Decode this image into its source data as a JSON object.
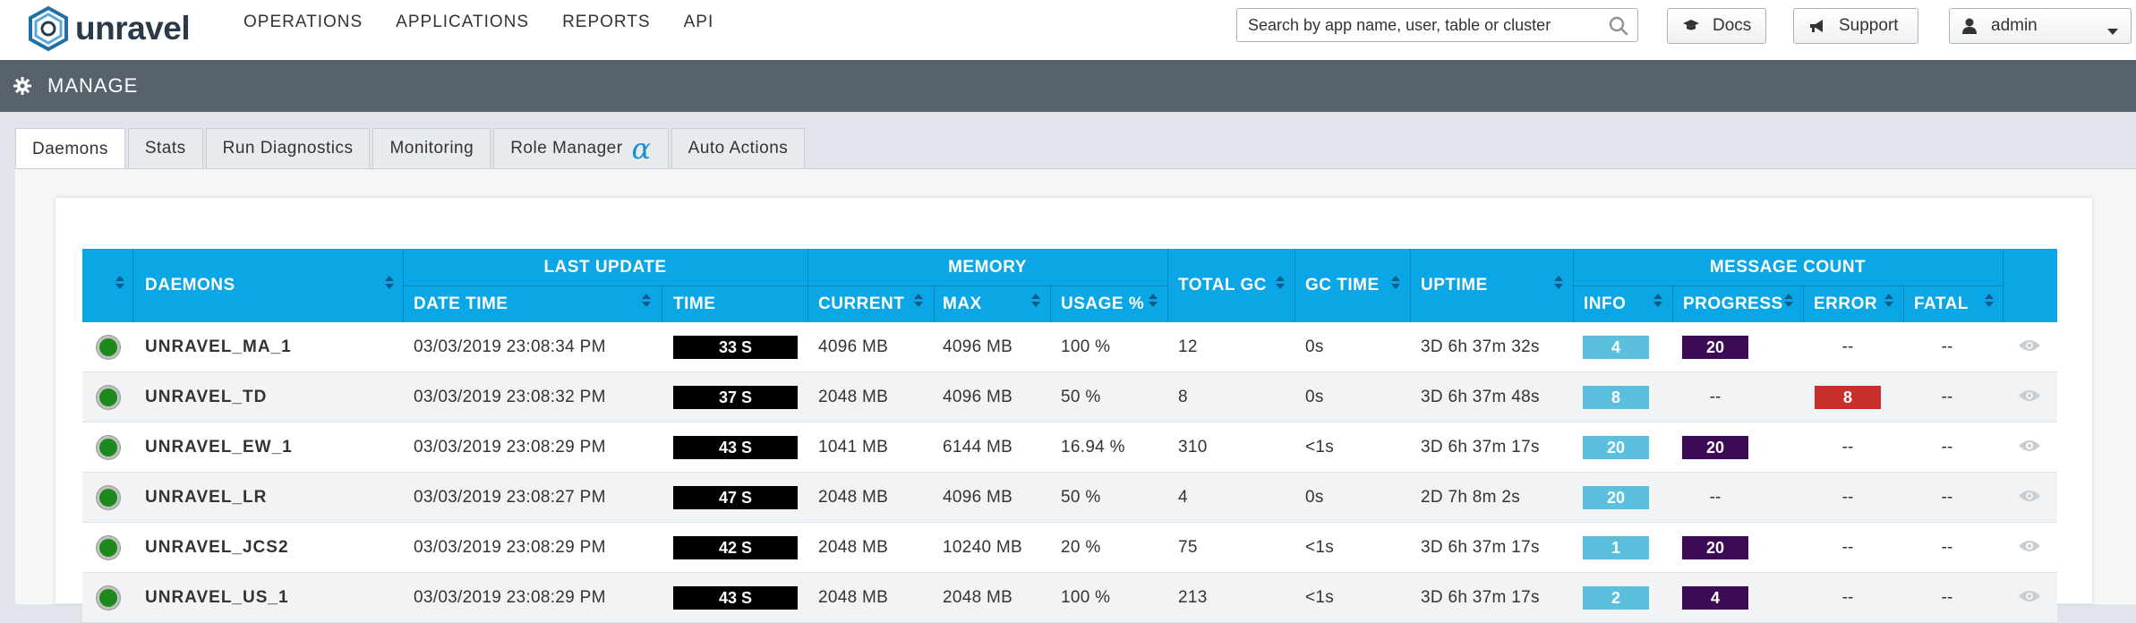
{
  "brand": {
    "name": "unravel"
  },
  "nav": [
    "OPERATIONS",
    "APPLICATIONS",
    "REPORTS",
    "API"
  ],
  "search": {
    "placeholder": "Search by app name, user, table or cluster"
  },
  "buttons": {
    "docs": "Docs",
    "support": "Support",
    "user": "admin"
  },
  "page": {
    "title": "MANAGE"
  },
  "tabs": [
    {
      "label": "Daemons",
      "active": true
    },
    {
      "label": "Stats"
    },
    {
      "label": "Run Diagnostics"
    },
    {
      "label": "Monitoring"
    },
    {
      "label": "Role Manager",
      "badge": "α"
    },
    {
      "label": "Auto Actions"
    }
  ],
  "table": {
    "group_headers": {
      "last_update": "LAST UPDATE",
      "memory": "MEMORY",
      "message_count": "MESSAGE COUNT"
    },
    "headers": {
      "daemons": "DAEMONS",
      "date_time": "DATE TIME",
      "time": "TIME",
      "current": "CURRENT",
      "max": "MAX",
      "usage": "USAGE %",
      "total_gc": "TOTAL GC",
      "gc_time": "GC TIME",
      "uptime": "UPTIME",
      "info": "INFO",
      "progress": "PROGRESS",
      "error": "ERROR",
      "fatal": "FATAL"
    },
    "rows": [
      {
        "name": "UNRAVEL_MA_1",
        "date": "03/03/2019 23:08:34 PM",
        "time": "33 S",
        "current": "4096 MB",
        "max": "4096 MB",
        "usage": "100 %",
        "gc": "12",
        "gc_time": "0s",
        "uptime": "3D 6h 37m 32s",
        "info": "4",
        "progress": "20",
        "error": "--",
        "fatal": "--"
      },
      {
        "name": "UNRAVEL_TD",
        "date": "03/03/2019 23:08:32 PM",
        "time": "37 S",
        "current": "2048 MB",
        "max": "4096 MB",
        "usage": "50 %",
        "gc": "8",
        "gc_time": "0s",
        "uptime": "3D 6h 37m 48s",
        "info": "8",
        "progress": "--",
        "error": "8",
        "fatal": "--"
      },
      {
        "name": "UNRAVEL_EW_1",
        "date": "03/03/2019 23:08:29 PM",
        "time": "43 S",
        "current": "1041 MB",
        "max": "6144 MB",
        "usage": "16.94 %",
        "gc": "310",
        "gc_time": "<1s",
        "uptime": "3D 6h 37m 17s",
        "info": "20",
        "progress": "20",
        "error": "--",
        "fatal": "--"
      },
      {
        "name": "UNRAVEL_LR",
        "date": "03/03/2019 23:08:27 PM",
        "time": "47 S",
        "current": "2048 MB",
        "max": "4096 MB",
        "usage": "50 %",
        "gc": "4",
        "gc_time": "0s",
        "uptime": "2D 7h 8m 2s",
        "info": "20",
        "progress": "--",
        "error": "--",
        "fatal": "--"
      },
      {
        "name": "UNRAVEL_JCS2",
        "date": "03/03/2019 23:08:29 PM",
        "time": "42 S",
        "current": "2048 MB",
        "max": "10240 MB",
        "usage": "20 %",
        "gc": "75",
        "gc_time": "<1s",
        "uptime": "3D 6h 37m 17s",
        "info": "1",
        "progress": "20",
        "error": "--",
        "fatal": "--"
      },
      {
        "name": "UNRAVEL_US_1",
        "date": "03/03/2019 23:08:29 PM",
        "time": "43 S",
        "current": "2048 MB",
        "max": "2048 MB",
        "usage": "100 %",
        "gc": "213",
        "gc_time": "<1s",
        "uptime": "3D 6h 37m 17s",
        "info": "2",
        "progress": "4",
        "error": "--",
        "fatal": "--"
      }
    ]
  }
}
